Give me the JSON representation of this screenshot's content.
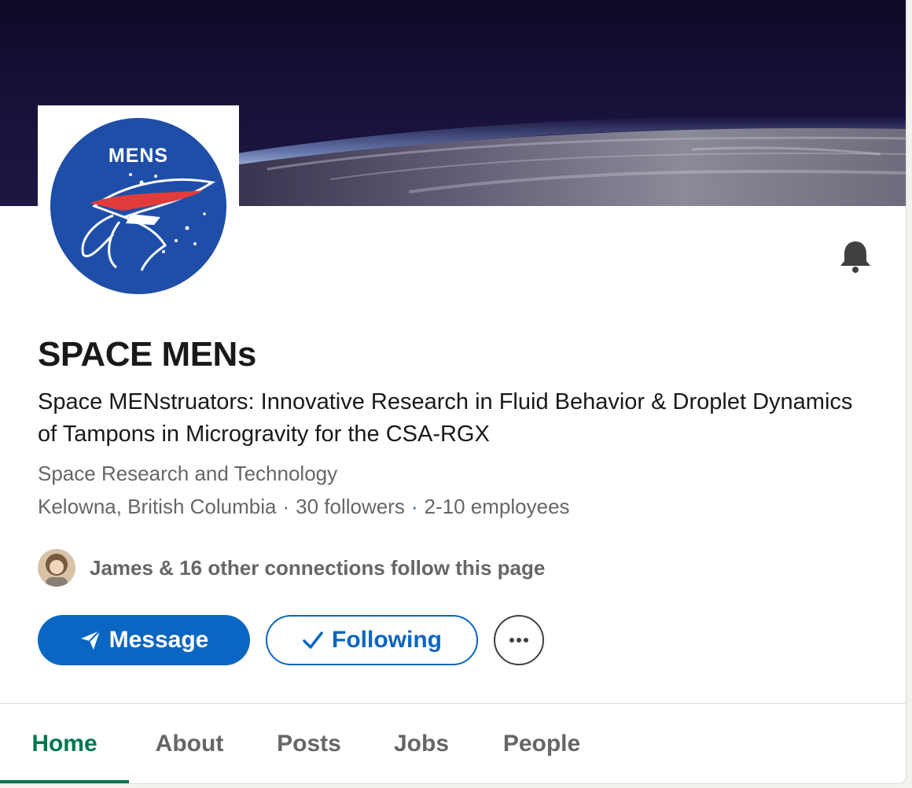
{
  "company": {
    "name": "SPACE MENs",
    "tagline": "Space MENstruators: Innovative Research in Fluid Behavior & Droplet Dynamics of Tampons in Microgravity for the CSA-RGX",
    "industry": "Space Research and Technology",
    "location": "Kelowna, British Columbia",
    "followers": "30 followers",
    "employees": "2-10 employees",
    "separator": "·"
  },
  "logo": {
    "text": "MENS",
    "background_color": "#1f4ea8",
    "accent_color": "#e23b3b"
  },
  "connections": {
    "text": "James & 16 other connections follow this page"
  },
  "actions": {
    "message_label": "Message",
    "following_label": "Following",
    "more_label": "···"
  },
  "tabs": [
    {
      "label": "Home",
      "active": true
    },
    {
      "label": "About",
      "active": false
    },
    {
      "label": "Posts",
      "active": false
    },
    {
      "label": "Jobs",
      "active": false
    },
    {
      "label": "People",
      "active": false
    }
  ],
  "icons": {
    "bell": "bell-icon",
    "message": "send-icon",
    "following": "checkmark-icon",
    "more": "more-icon"
  },
  "colors": {
    "primary": "#0a66c2",
    "active_tab": "#01754f",
    "muted_text": "#666666",
    "text": "#191919"
  }
}
